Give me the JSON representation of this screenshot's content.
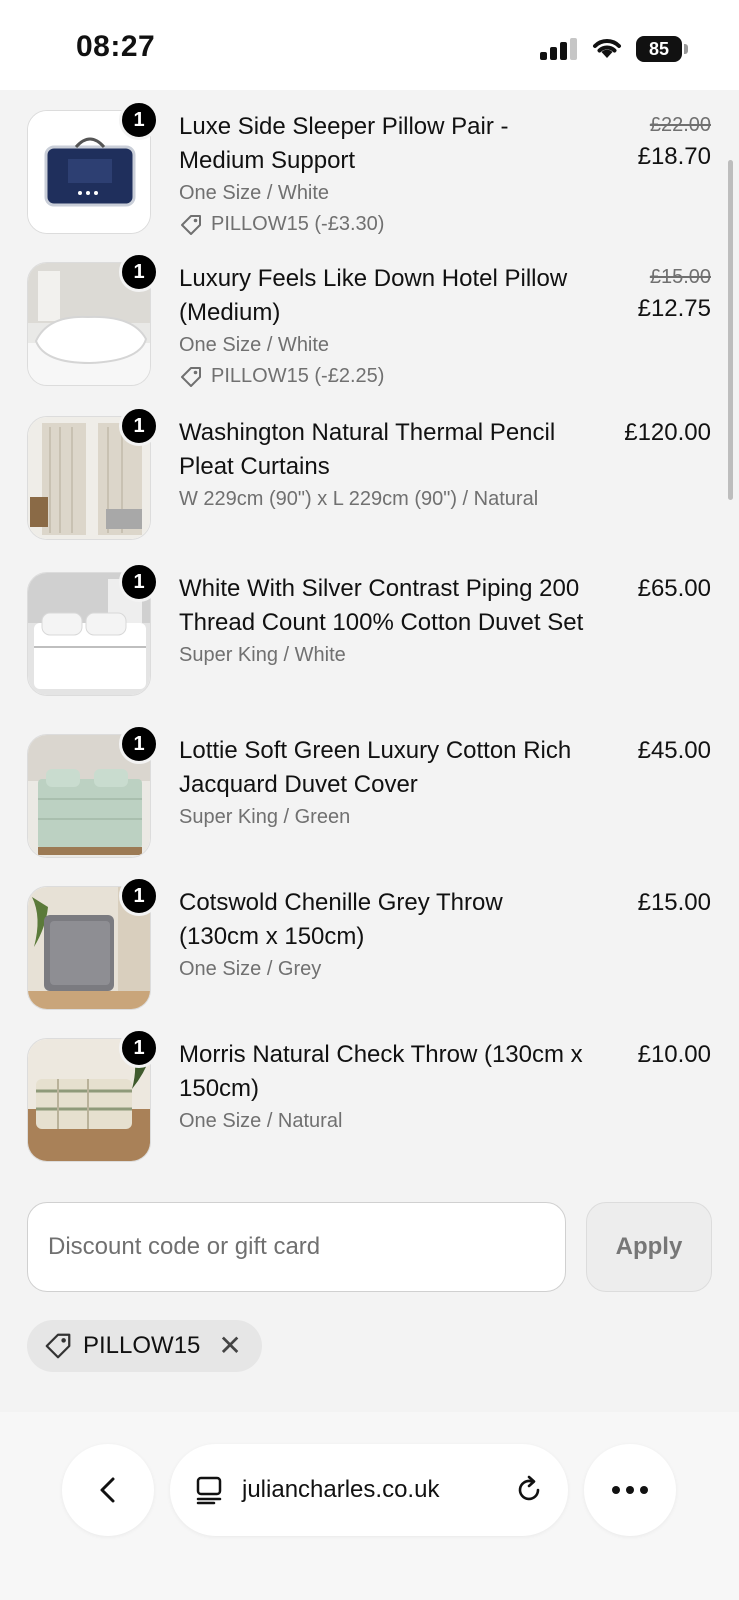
{
  "status_bar": {
    "time": "08:27",
    "battery": "85"
  },
  "cart": {
    "items": [
      {
        "name": "Luxe Side Sleeper Pillow Pair - Medium Support",
        "variant": "One Size / White",
        "discount": "PILLOW15 (-£3.30)",
        "original_price": "£22.00",
        "price": "£18.70",
        "quantity": "1"
      },
      {
        "name": "Luxury Feels Like Down Hotel Pillow (Medium)",
        "variant": "One Size / White",
        "discount": "PILLOW15 (-£2.25)",
        "original_price": "£15.00",
        "price": "£12.75",
        "quantity": "1"
      },
      {
        "name": "Washington Natural Thermal Pencil Pleat Curtains",
        "variant": "W 229cm (90\") x L 229cm (90\") / Natural",
        "price": "£120.00",
        "quantity": "1"
      },
      {
        "name": "White With Silver Contrast Piping 200 Thread Count 100% Cotton Duvet Set",
        "variant": "Super King / White",
        "price": "£65.00",
        "quantity": "1"
      },
      {
        "name": "Lottie Soft Green Luxury Cotton Rich Jacquard Duvet Cover",
        "variant": "Super King / Green",
        "price": "£45.00",
        "quantity": "1"
      },
      {
        "name": "Cotswold Chenille Grey Throw (130cm x 150cm)",
        "variant": "One Size / Grey",
        "price": "£15.00",
        "quantity": "1"
      },
      {
        "name": "Morris Natural Check Throw (130cm x 150cm)",
        "variant": "One Size / Natural",
        "price": "£10.00",
        "quantity": "1"
      }
    ]
  },
  "discount": {
    "placeholder": "Discount code or gift card",
    "apply_label": "Apply",
    "applied_code": "PILLOW15"
  },
  "browser": {
    "url": "juliancharles.co.uk"
  },
  "colors": {
    "accent": "#000000",
    "muted_text": "#707070",
    "background": "#f3f3f3"
  }
}
